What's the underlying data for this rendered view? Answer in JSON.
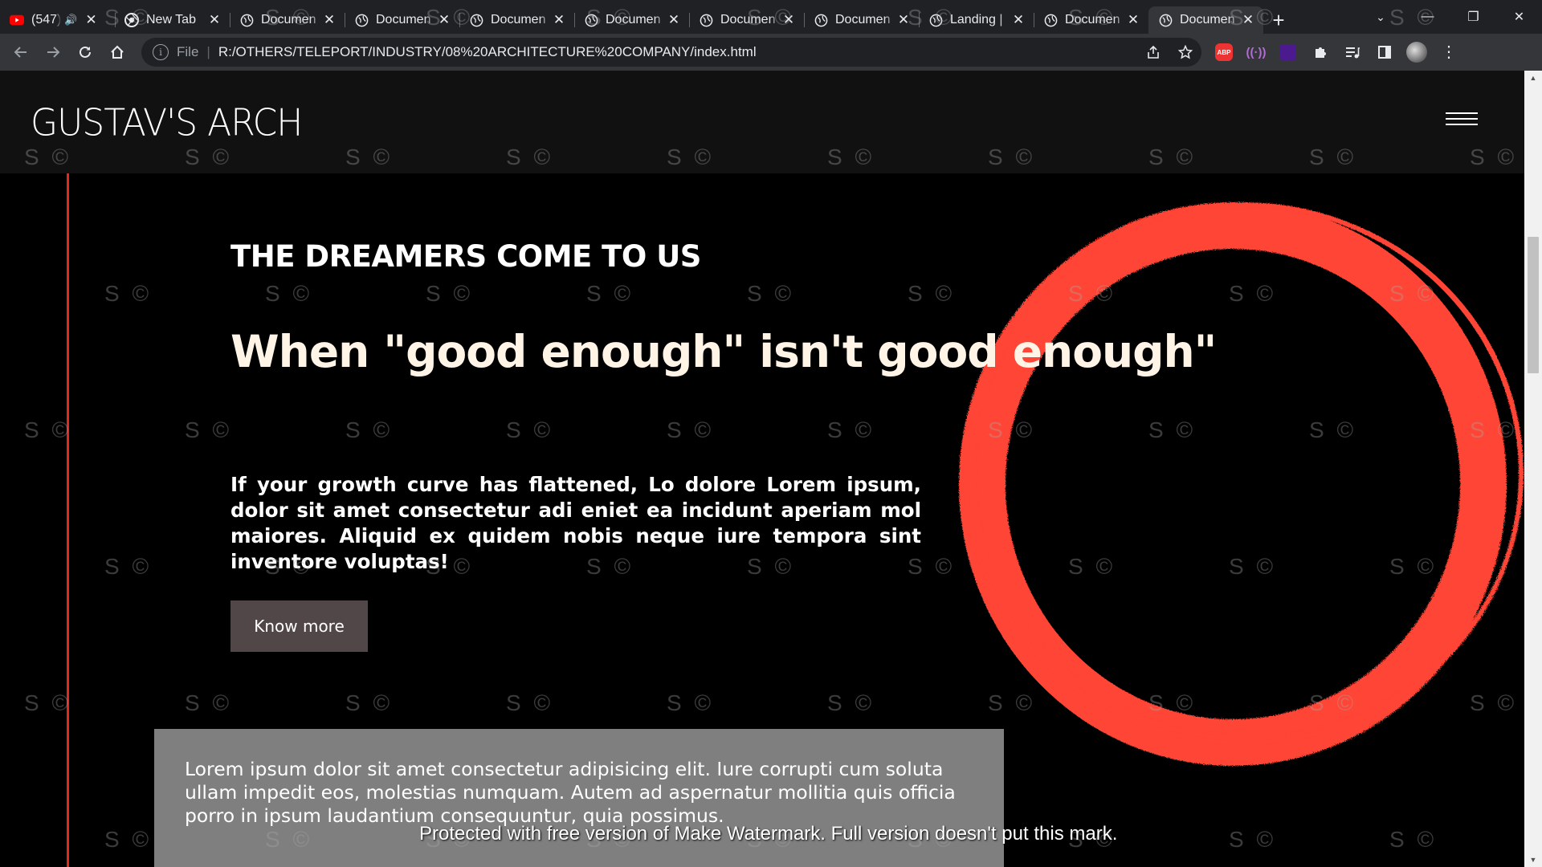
{
  "browser": {
    "tabs": [
      {
        "title": "(547)",
        "favicon": "youtube-icon",
        "audio": true
      },
      {
        "title": "New Tab",
        "favicon": "chrome-icon"
      },
      {
        "title": "Documen",
        "favicon": "globe-icon"
      },
      {
        "title": "Documen",
        "favicon": "globe-icon"
      },
      {
        "title": "Documen",
        "favicon": "globe-icon"
      },
      {
        "title": "Documen",
        "favicon": "globe-icon"
      },
      {
        "title": "Documen",
        "favicon": "globe-icon"
      },
      {
        "title": "Documen",
        "favicon": "globe-icon"
      },
      {
        "title": "Landing |",
        "favicon": "globe-icon"
      },
      {
        "title": "Documen",
        "favicon": "globe-icon"
      },
      {
        "title": "Documen",
        "favicon": "globe-icon",
        "active": true
      }
    ],
    "address": {
      "scheme": "File",
      "url": "R:/OTHERS/TELEPORT/INDUSTRY/08%20ARCHITECTURE%20COMPANY/index.html"
    },
    "extensions": [
      "abp-icon",
      "cast-icon",
      "purple-square-icon",
      "puzzle-icon",
      "media-icon",
      "sidepanel-icon",
      "avatar"
    ]
  },
  "site": {
    "brand": "GUSTAV'S ARCH",
    "eyebrow": "THE DREAMERS COME TO US",
    "headline": "When \"good enough\" isn't good enough\"",
    "lede": "If your growth curve has flattened, Lo dolore Lorem ipsum, dolor sit amet consectetur adi eniet ea incidunt aperiam mol maiores. Aliquid ex quidem nobis neque iure tempora sint inventore voluptas!",
    "cta_label": "Know more",
    "note": "Lorem ipsum dolor sit amet consectetur adipisicing elit. Iure corrupti cum soluta ullam impedit eos, molestias numquam. Autem ad aspernatur mollitia quis officia porro in ipsum laudantium consequuntur, quia possimus.",
    "colors": {
      "accent": "#ff4436",
      "line": "#e3281f",
      "button": "#524748",
      "note_bg": "#7f7f7f",
      "header_bg": "#111111"
    }
  },
  "watermark": {
    "mark": "S ©",
    "notice": "Protected with free version of Make Watermark. Full version doesn't put this mark."
  }
}
